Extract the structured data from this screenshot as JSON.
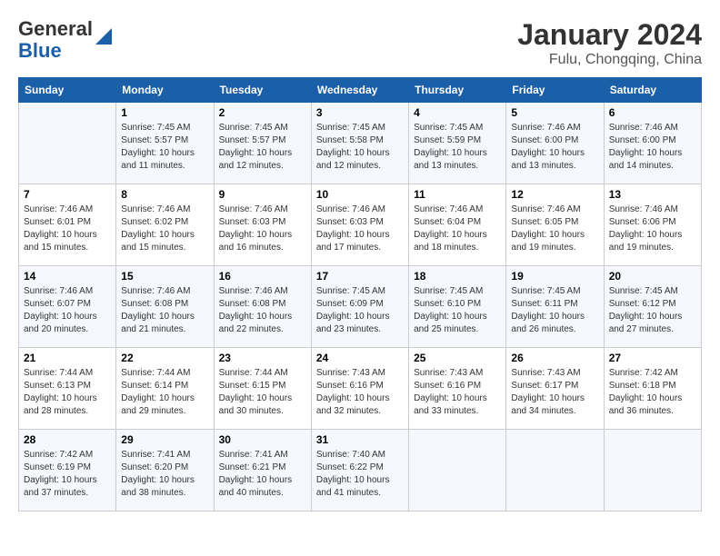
{
  "header": {
    "logo_general": "General",
    "logo_blue": "Blue",
    "month_year": "January 2024",
    "location": "Fulu, Chongqing, China"
  },
  "calendar": {
    "days_of_week": [
      "Sunday",
      "Monday",
      "Tuesday",
      "Wednesday",
      "Thursday",
      "Friday",
      "Saturday"
    ],
    "weeks": [
      [
        {
          "day": "",
          "info": ""
        },
        {
          "day": "1",
          "info": "Sunrise: 7:45 AM\nSunset: 5:57 PM\nDaylight: 10 hours\nand 11 minutes."
        },
        {
          "day": "2",
          "info": "Sunrise: 7:45 AM\nSunset: 5:57 PM\nDaylight: 10 hours\nand 12 minutes."
        },
        {
          "day": "3",
          "info": "Sunrise: 7:45 AM\nSunset: 5:58 PM\nDaylight: 10 hours\nand 12 minutes."
        },
        {
          "day": "4",
          "info": "Sunrise: 7:45 AM\nSunset: 5:59 PM\nDaylight: 10 hours\nand 13 minutes."
        },
        {
          "day": "5",
          "info": "Sunrise: 7:46 AM\nSunset: 6:00 PM\nDaylight: 10 hours\nand 13 minutes."
        },
        {
          "day": "6",
          "info": "Sunrise: 7:46 AM\nSunset: 6:00 PM\nDaylight: 10 hours\nand 14 minutes."
        }
      ],
      [
        {
          "day": "7",
          "info": "Sunrise: 7:46 AM\nSunset: 6:01 PM\nDaylight: 10 hours\nand 15 minutes."
        },
        {
          "day": "8",
          "info": "Sunrise: 7:46 AM\nSunset: 6:02 PM\nDaylight: 10 hours\nand 15 minutes."
        },
        {
          "day": "9",
          "info": "Sunrise: 7:46 AM\nSunset: 6:03 PM\nDaylight: 10 hours\nand 16 minutes."
        },
        {
          "day": "10",
          "info": "Sunrise: 7:46 AM\nSunset: 6:03 PM\nDaylight: 10 hours\nand 17 minutes."
        },
        {
          "day": "11",
          "info": "Sunrise: 7:46 AM\nSunset: 6:04 PM\nDaylight: 10 hours\nand 18 minutes."
        },
        {
          "day": "12",
          "info": "Sunrise: 7:46 AM\nSunset: 6:05 PM\nDaylight: 10 hours\nand 19 minutes."
        },
        {
          "day": "13",
          "info": "Sunrise: 7:46 AM\nSunset: 6:06 PM\nDaylight: 10 hours\nand 19 minutes."
        }
      ],
      [
        {
          "day": "14",
          "info": "Sunrise: 7:46 AM\nSunset: 6:07 PM\nDaylight: 10 hours\nand 20 minutes."
        },
        {
          "day": "15",
          "info": "Sunrise: 7:46 AM\nSunset: 6:08 PM\nDaylight: 10 hours\nand 21 minutes."
        },
        {
          "day": "16",
          "info": "Sunrise: 7:46 AM\nSunset: 6:08 PM\nDaylight: 10 hours\nand 22 minutes."
        },
        {
          "day": "17",
          "info": "Sunrise: 7:45 AM\nSunset: 6:09 PM\nDaylight: 10 hours\nand 23 minutes."
        },
        {
          "day": "18",
          "info": "Sunrise: 7:45 AM\nSunset: 6:10 PM\nDaylight: 10 hours\nand 25 minutes."
        },
        {
          "day": "19",
          "info": "Sunrise: 7:45 AM\nSunset: 6:11 PM\nDaylight: 10 hours\nand 26 minutes."
        },
        {
          "day": "20",
          "info": "Sunrise: 7:45 AM\nSunset: 6:12 PM\nDaylight: 10 hours\nand 27 minutes."
        }
      ],
      [
        {
          "day": "21",
          "info": "Sunrise: 7:44 AM\nSunset: 6:13 PM\nDaylight: 10 hours\nand 28 minutes."
        },
        {
          "day": "22",
          "info": "Sunrise: 7:44 AM\nSunset: 6:14 PM\nDaylight: 10 hours\nand 29 minutes."
        },
        {
          "day": "23",
          "info": "Sunrise: 7:44 AM\nSunset: 6:15 PM\nDaylight: 10 hours\nand 30 minutes."
        },
        {
          "day": "24",
          "info": "Sunrise: 7:43 AM\nSunset: 6:16 PM\nDaylight: 10 hours\nand 32 minutes."
        },
        {
          "day": "25",
          "info": "Sunrise: 7:43 AM\nSunset: 6:16 PM\nDaylight: 10 hours\nand 33 minutes."
        },
        {
          "day": "26",
          "info": "Sunrise: 7:43 AM\nSunset: 6:17 PM\nDaylight: 10 hours\nand 34 minutes."
        },
        {
          "day": "27",
          "info": "Sunrise: 7:42 AM\nSunset: 6:18 PM\nDaylight: 10 hours\nand 36 minutes."
        }
      ],
      [
        {
          "day": "28",
          "info": "Sunrise: 7:42 AM\nSunset: 6:19 PM\nDaylight: 10 hours\nand 37 minutes."
        },
        {
          "day": "29",
          "info": "Sunrise: 7:41 AM\nSunset: 6:20 PM\nDaylight: 10 hours\nand 38 minutes."
        },
        {
          "day": "30",
          "info": "Sunrise: 7:41 AM\nSunset: 6:21 PM\nDaylight: 10 hours\nand 40 minutes."
        },
        {
          "day": "31",
          "info": "Sunrise: 7:40 AM\nSunset: 6:22 PM\nDaylight: 10 hours\nand 41 minutes."
        },
        {
          "day": "",
          "info": ""
        },
        {
          "day": "",
          "info": ""
        },
        {
          "day": "",
          "info": ""
        }
      ]
    ]
  }
}
